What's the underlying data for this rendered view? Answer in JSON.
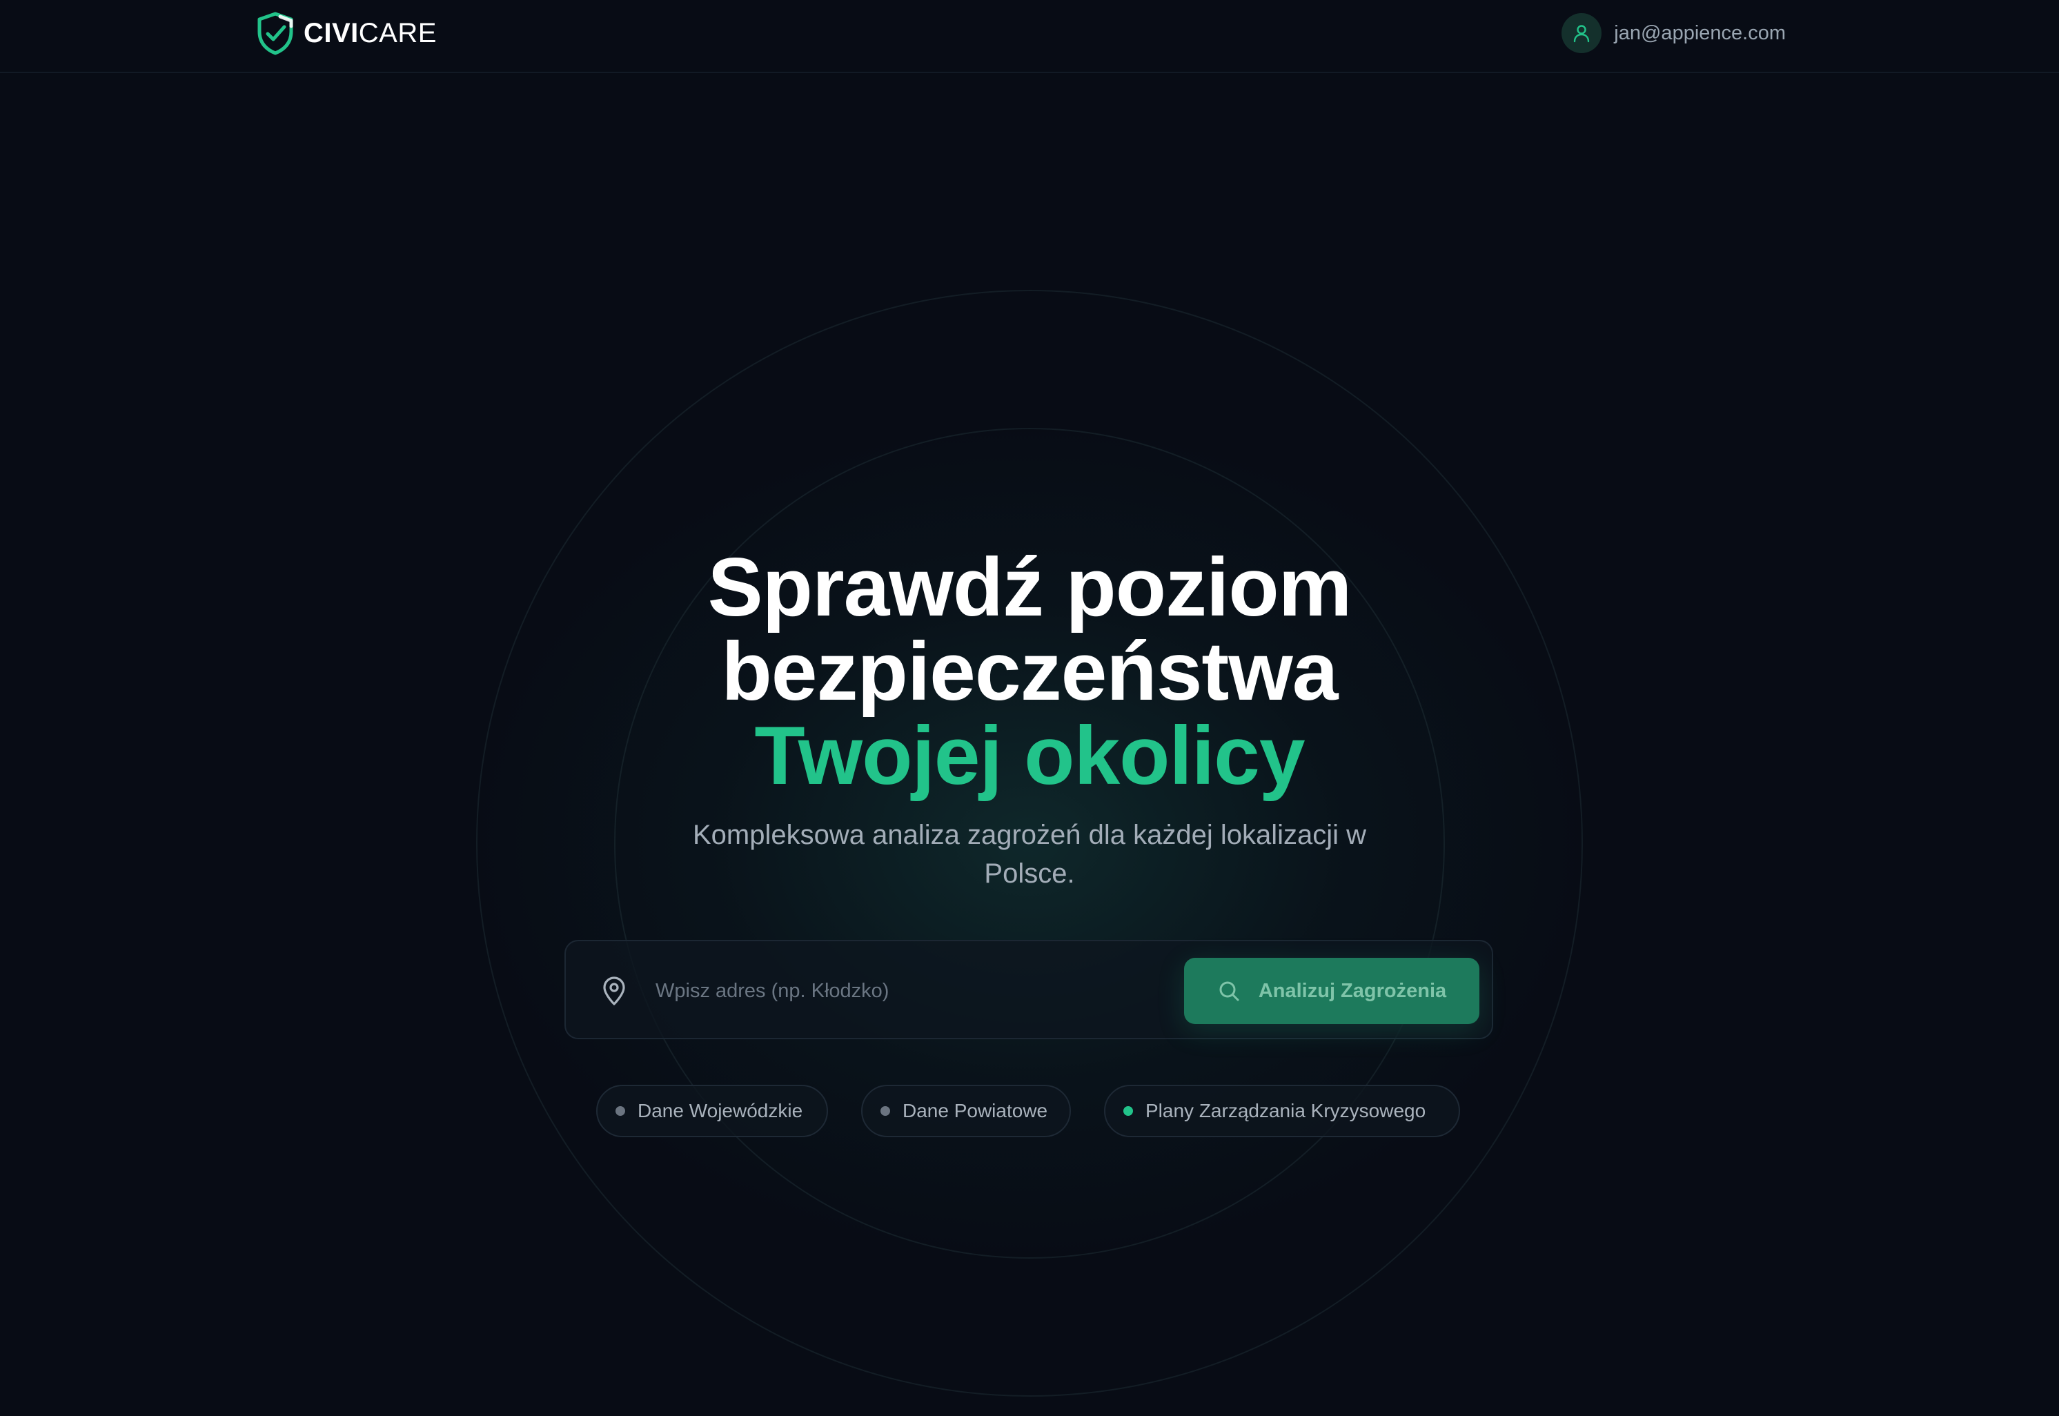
{
  "brand": {
    "bold": "CIVI",
    "light": "CARE",
    "accent_color": "#22c38a"
  },
  "header": {
    "user_email": "jan@appience.com",
    "user_icon": "user-icon"
  },
  "hero": {
    "title_line1": "Sprawdź poziom",
    "title_line2": "bezpieczeństwa",
    "title_accent": "Twojej okolicy",
    "subtitle": "Kompleksowa analiza zagrożeń dla każdej lokalizacji w Polsce."
  },
  "search": {
    "placeholder": "Wpisz adres (np. Kłodzko)",
    "value": "",
    "icon": "map-pin-icon",
    "button_label": "Analizuj Zagrożenia",
    "button_icon": "search-icon",
    "button_color": "#1d7a5c"
  },
  "data_sources": [
    {
      "label": "Dane Wojewódzkie",
      "status_color": "#6b7480"
    },
    {
      "label": "Dane Powiatowe",
      "status_color": "#6b7480"
    },
    {
      "label": "Plany Zarządzania Kryzysowego",
      "status_color": "#22c38a"
    }
  ]
}
